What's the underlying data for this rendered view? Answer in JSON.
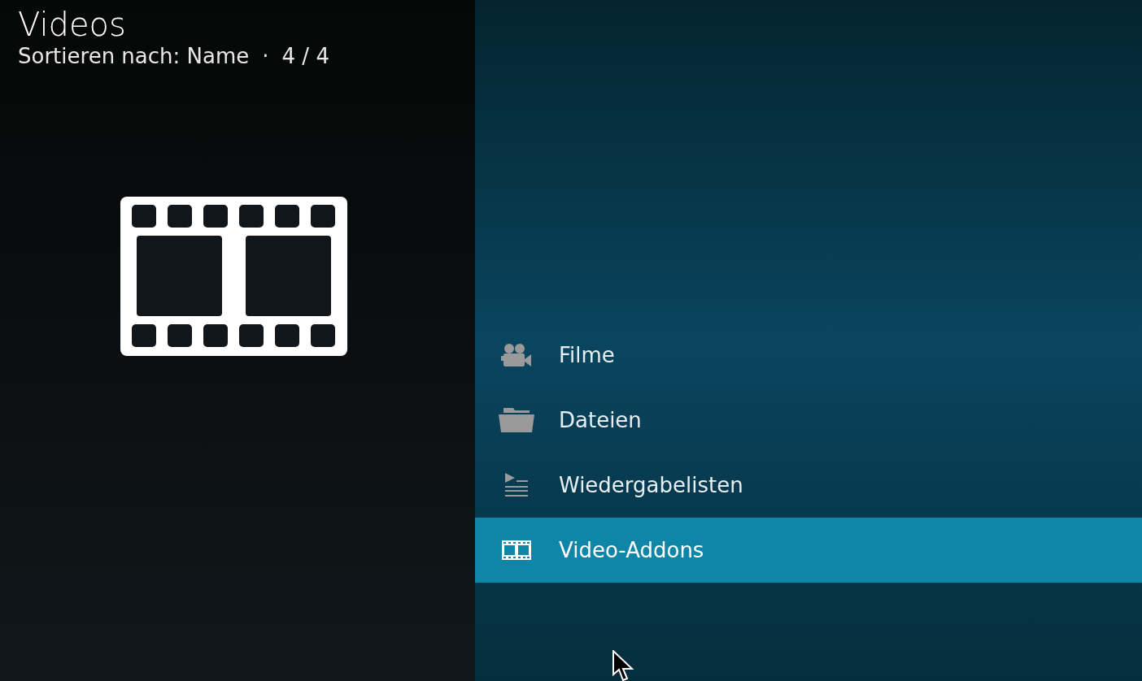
{
  "header": {
    "title": "Videos",
    "sort": "Sortieren nach: Name",
    "separator": "·",
    "count": "4 / 4"
  },
  "menu": [
    {
      "label": "Filme",
      "kind": "camera",
      "selected": false
    },
    {
      "label": "Dateien",
      "kind": "folder",
      "selected": false
    },
    {
      "label": "Wiedergabelisten",
      "kind": "playlist",
      "selected": false
    },
    {
      "label": "Video-Addons",
      "kind": "film",
      "selected": true
    }
  ]
}
